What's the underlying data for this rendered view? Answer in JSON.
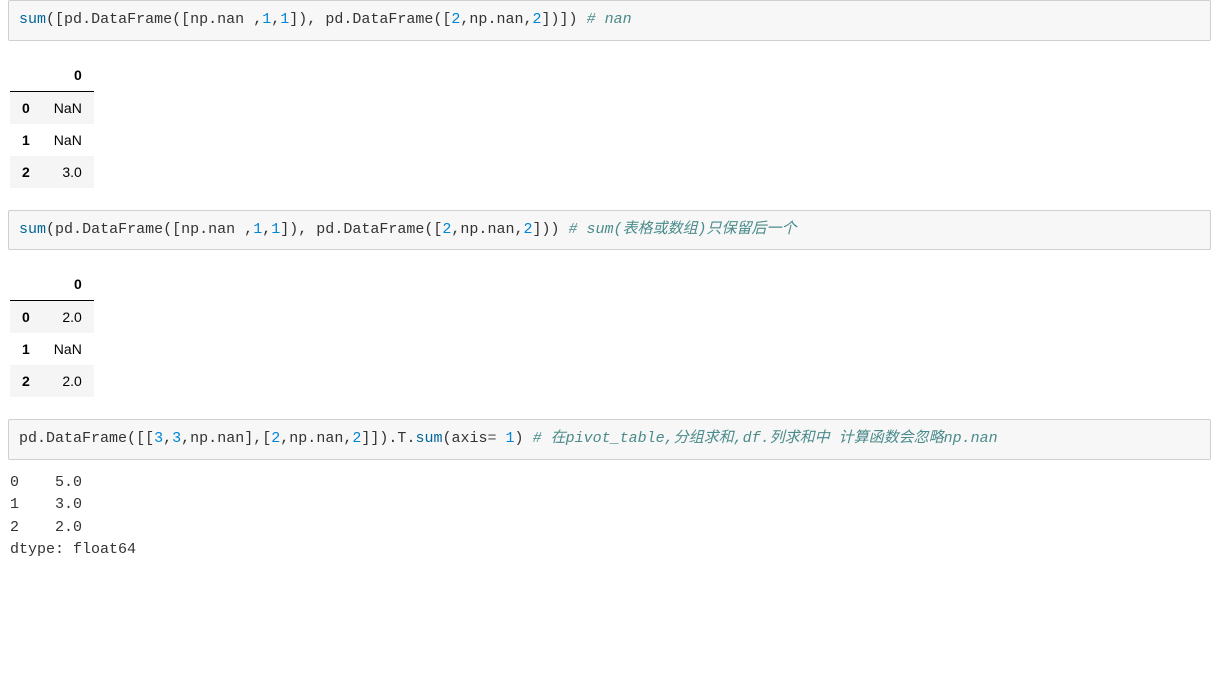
{
  "cell1": {
    "fn": "sum",
    "lparen1": "(",
    "lbracket": "[",
    "pd1": "pd",
    "dot1": ".",
    "df1": "DataFrame",
    "lparen2": "(",
    "lbracket2": "[",
    "np1": "np",
    "dot2": ".",
    "nan1": "nan",
    "space1": " ",
    "comma1": ",",
    "num1": "1",
    "comma2": ",",
    "num2": "1",
    "rbracket2": "]",
    "rparen2": ")",
    "comma3": ",",
    "space2": " ",
    "pd2": "pd",
    "dot3": ".",
    "df2": "DataFrame",
    "lparen3": "(",
    "lbracket3": "[",
    "num3": "2",
    "comma4": ",",
    "np2": "np",
    "dot4": ".",
    "nan2": "nan",
    "comma5": ",",
    "num4": "2",
    "rbracket3": "]",
    "rparen3": ")",
    "rbracket": "]",
    "rparen1": ")",
    "space3": " ",
    "comment": "# nan"
  },
  "table1": {
    "col": "0",
    "rows": [
      {
        "idx": "0",
        "val": "NaN"
      },
      {
        "idx": "1",
        "val": "NaN"
      },
      {
        "idx": "2",
        "val": "3.0"
      }
    ]
  },
  "cell2": {
    "fn": "sum",
    "lparen1": "(",
    "pd1": "pd",
    "dot1": ".",
    "df1": "DataFrame",
    "lparen2": "(",
    "lbracket2": "[",
    "np1": "np",
    "dot2": ".",
    "nan1": "nan",
    "space1": " ",
    "comma1": ",",
    "num1": "1",
    "comma2": ",",
    "num2": "1",
    "rbracket2": "]",
    "rparen2": ")",
    "comma3": ",",
    "space2": " ",
    "pd2": "pd",
    "dot3": ".",
    "df2": "DataFrame",
    "lparen3": "(",
    "lbracket3": "[",
    "num3": "2",
    "comma4": ",",
    "np2": "np",
    "dot4": ".",
    "nan2": "nan",
    "comma5": ",",
    "num4": "2",
    "rbracket3": "]",
    "rparen3": ")",
    "rparen1": ")",
    "space3": " ",
    "comment": "# sum(表格或数组)只保留后一个"
  },
  "table2": {
    "col": "0",
    "rows": [
      {
        "idx": "0",
        "val": "2.0"
      },
      {
        "idx": "1",
        "val": "NaN"
      },
      {
        "idx": "2",
        "val": "2.0"
      }
    ]
  },
  "cell3": {
    "pd": "pd",
    "dot1": ".",
    "df": "DataFrame",
    "lparen1": "(",
    "lbracket1": "[",
    "lbracket2": "[",
    "n1": "3",
    "comma1": ",",
    "n2": "3",
    "comma2": ",",
    "np1": "np",
    "dot2": ".",
    "nan1": "nan",
    "rbracket2": "]",
    "comma3": ",",
    "lbracket3": "[",
    "n3": "2",
    "comma4": ",",
    "np2": "np",
    "dot3": ".",
    "nan2": "nan",
    "comma5": ",",
    "n4": "2",
    "rbracket3": "]",
    "rbracket1": "]",
    "rparen1": ")",
    "dot4": ".",
    "tattr": "T",
    "dot5": ".",
    "sumfn": "sum",
    "lparen2": "(",
    "axis": "axis",
    "eq": "=",
    "sp": " ",
    "axisval": "1",
    "rparen2": ")",
    "space": " ",
    "comment": "# 在pivot_table,分组求和,df.列求和中 计算函数会忽略np.nan"
  },
  "textout": {
    "line1": "0    5.0",
    "line2": "1    3.0",
    "line3": "2    2.0",
    "line4": "dtype: float64"
  }
}
